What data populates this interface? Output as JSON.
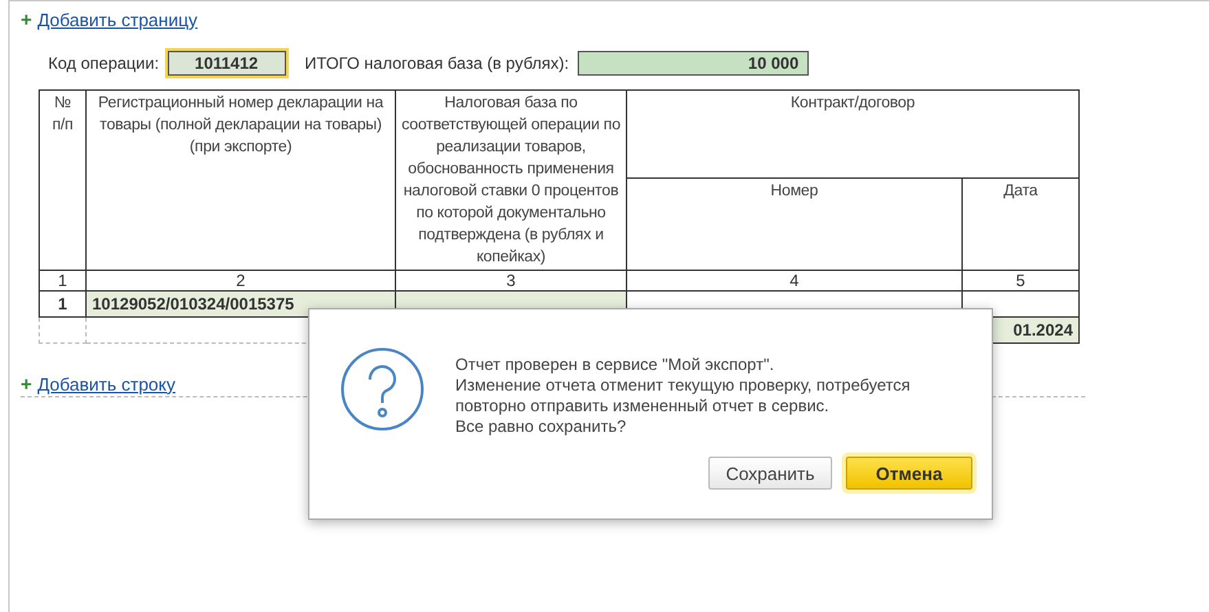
{
  "add_page_link": {
    "icon": "+",
    "label": "Добавить страницу"
  },
  "operation_code": {
    "label": "Код операции:",
    "value": "1011412"
  },
  "total": {
    "label": "ИТОГО налоговая база (в рублях):",
    "value": "10 000"
  },
  "table": {
    "columns": [
      "№ п/п",
      "Регистрационный номер декларации на товары (полной декларации на товары) (при экспорте)",
      "Налоговая база по соответствующей операции по реализации товаров, обоснованность применения налоговой ставки 0 процентов по которой документально подтверждена (в рублях и копейках)"
    ],
    "group_header": {
      "label": "Контракт/договор",
      "columns": [
        "Номер",
        "Дата"
      ]
    },
    "column_numbers": [
      "1",
      "2",
      "3",
      "4",
      "5"
    ],
    "rows": [
      {
        "number": "1",
        "declaration": "10129052/010324/0015375",
        "date": "01.2024"
      }
    ]
  },
  "add_row_link": {
    "icon": "+",
    "label": "Добавить строку"
  },
  "dialog": {
    "lines": [
      "Отчет проверен в сервисе \"Мой экспорт\".",
      "Изменение отчета отменит текущую проверку, потребуется",
      "повторно отправить измененный отчет в сервис.",
      "Все равно сохранить?"
    ],
    "buttons": [
      {
        "label": "Сохранить",
        "kind": "default"
      },
      {
        "label": "Отмена",
        "kind": "primary"
      }
    ]
  }
}
